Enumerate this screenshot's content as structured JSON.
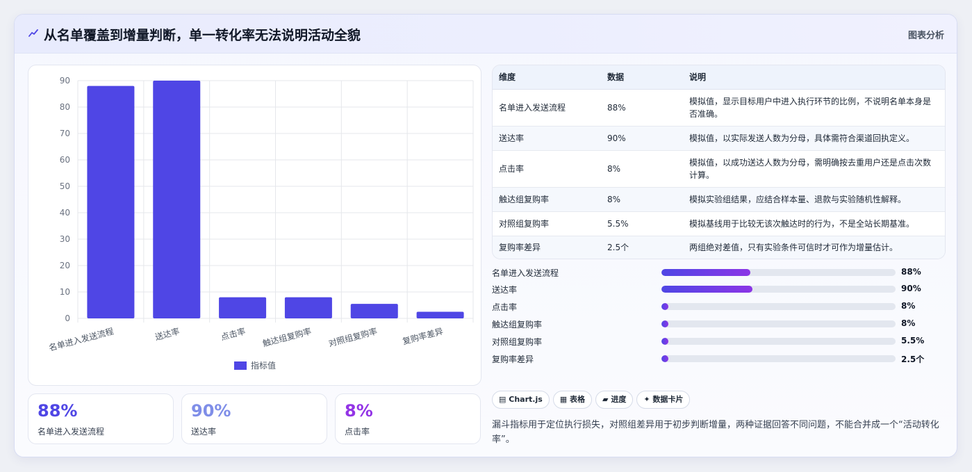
{
  "header": {
    "title": "从名单覆盖到增量判断，单一转化率无法说明活动全貌",
    "link_label": "图表分析",
    "icon": "trend-icon"
  },
  "colors": {
    "bar": "#4f46e5",
    "stat1": "#4f46e5",
    "stat2": "#7f8ee8",
    "stat3": "#9334e6",
    "progress_start": "#4f46e5",
    "progress_end": "#8b35e6"
  },
  "chart_data": {
    "type": "bar",
    "categories": [
      "名单进入发送流程",
      "送达率",
      "点击率",
      "触达组复购率",
      "对照组复购率",
      "复购率差异"
    ],
    "series": [
      {
        "name": "指标值",
        "values": [
          88,
          90,
          8,
          8,
          5.5,
          2.5
        ]
      }
    ],
    "ylim": [
      0,
      90
    ],
    "yticks": [
      0,
      10,
      20,
      30,
      40,
      50,
      60,
      70,
      80,
      90
    ],
    "grid": true,
    "legend": "bottom"
  },
  "stats": [
    {
      "value": "88%",
      "label": "名单进入发送流程"
    },
    {
      "value": "90%",
      "label": "送达率"
    },
    {
      "value": "8%",
      "label": "点击率"
    }
  ],
  "table": {
    "headers": [
      "维度",
      "数据",
      "说明"
    ],
    "rows": [
      [
        "名单进入发送流程",
        "88%",
        "模拟值，显示目标用户中进入执行环节的比例，不说明名单本身是否准确。"
      ],
      [
        "送达率",
        "90%",
        "模拟值，以实际发送人数为分母，具体需符合渠道回执定义。"
      ],
      [
        "点击率",
        "8%",
        "模拟值，以成功送达人数为分母，需明确按去重用户还是点击次数计算。"
      ],
      [
        "触达组复购率",
        "8%",
        "模拟实验组结果，应结合样本量、退款与实验随机性解释。"
      ],
      [
        "对照组复购率",
        "5.5%",
        "模拟基线用于比较无该次触达时的行为，不是全站长期基准。"
      ],
      [
        "复购率差异",
        "2.5个",
        "两组绝对差值，只有实验条件可信时才可作为增量估计。"
      ]
    ]
  },
  "progress": [
    {
      "label": "名单进入发送流程",
      "value": "88%",
      "fraction": 0.38
    },
    {
      "label": "送达率",
      "value": "90%",
      "fraction": 0.39
    },
    {
      "label": "点击率",
      "value": "8%",
      "fraction": 0.03
    },
    {
      "label": "触达组复购率",
      "value": "8%",
      "fraction": 0.03
    },
    {
      "label": "对照组复购率",
      "value": "5.5%",
      "fraction": 0.03
    },
    {
      "label": "复购率差异",
      "value": "2.5个",
      "fraction": 0.03
    }
  ],
  "tags": [
    {
      "icon": "chart-icon",
      "glyph": "▤",
      "label": "Chart.js"
    },
    {
      "icon": "table-icon",
      "glyph": "▦",
      "label": "表格"
    },
    {
      "icon": "progress-icon",
      "glyph": "▰",
      "label": "进度"
    },
    {
      "icon": "sparkle-icon",
      "glyph": "✦",
      "label": "数据卡片"
    }
  ],
  "note": "漏斗指标用于定位执行损失，对照组差异用于初步判断增量，两种证据回答不同问题，不能合并成一个“活动转化率”。"
}
